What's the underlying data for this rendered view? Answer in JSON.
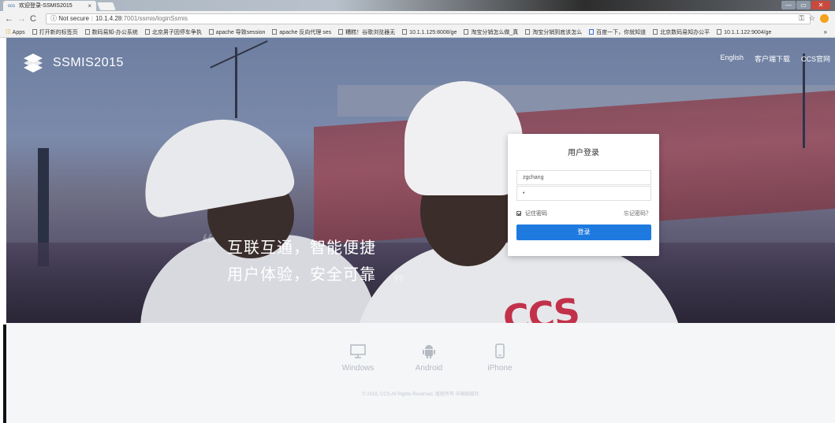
{
  "browser": {
    "tab_title": "欢迎登录-SSMIS2015",
    "tab_favicon": "ccs",
    "tab_close": "×",
    "url_security": "ⓘ Not secure",
    "url_host": "10.1.4.28",
    "url_path": ":7001/ssmis/loginSsmis",
    "bookmarks": [
      "打开新的标签页",
      "数码易知-办公系统",
      "北京男子因停车争执",
      "apache 导致session",
      "apache 反向代理 ses",
      "糟糕！谷歌浏览器无",
      "10.1.1.125:8008/ge",
      "淘宝分销怎么做_真",
      "淘宝分销到底该怎么",
      "百度一下，你就知道",
      "北京数码易知办公平",
      "10.1.1.122:9004/ge"
    ],
    "apps_label": "Apps",
    "more": "»"
  },
  "header": {
    "brand": "SSMIS2015",
    "links": [
      "English",
      "客户端下载",
      "CCS官网"
    ]
  },
  "slogan": {
    "line1": "互联互通，智能便捷",
    "line2": "用户体验，安全可靠",
    "quote_open": "❝",
    "quote_close": "❞"
  },
  "login": {
    "title": "用户登录",
    "username": "zgchang",
    "password": "•",
    "remember_label": "记住密码",
    "remember_checked": true,
    "forgot_label": "忘记密码？",
    "submit_label": "登录",
    "button_color": "#1f7ae0"
  },
  "footer": {
    "platforms": [
      {
        "label": "Windows",
        "icon": "monitor-icon"
      },
      {
        "label": "Android",
        "icon": "android-icon"
      },
      {
        "label": "iPhone",
        "icon": "phone-icon"
      }
    ],
    "copyright": "© 2016, CCS All Rights Reserved. 版权所有 中国船级社"
  },
  "hero_mark": "CCS"
}
